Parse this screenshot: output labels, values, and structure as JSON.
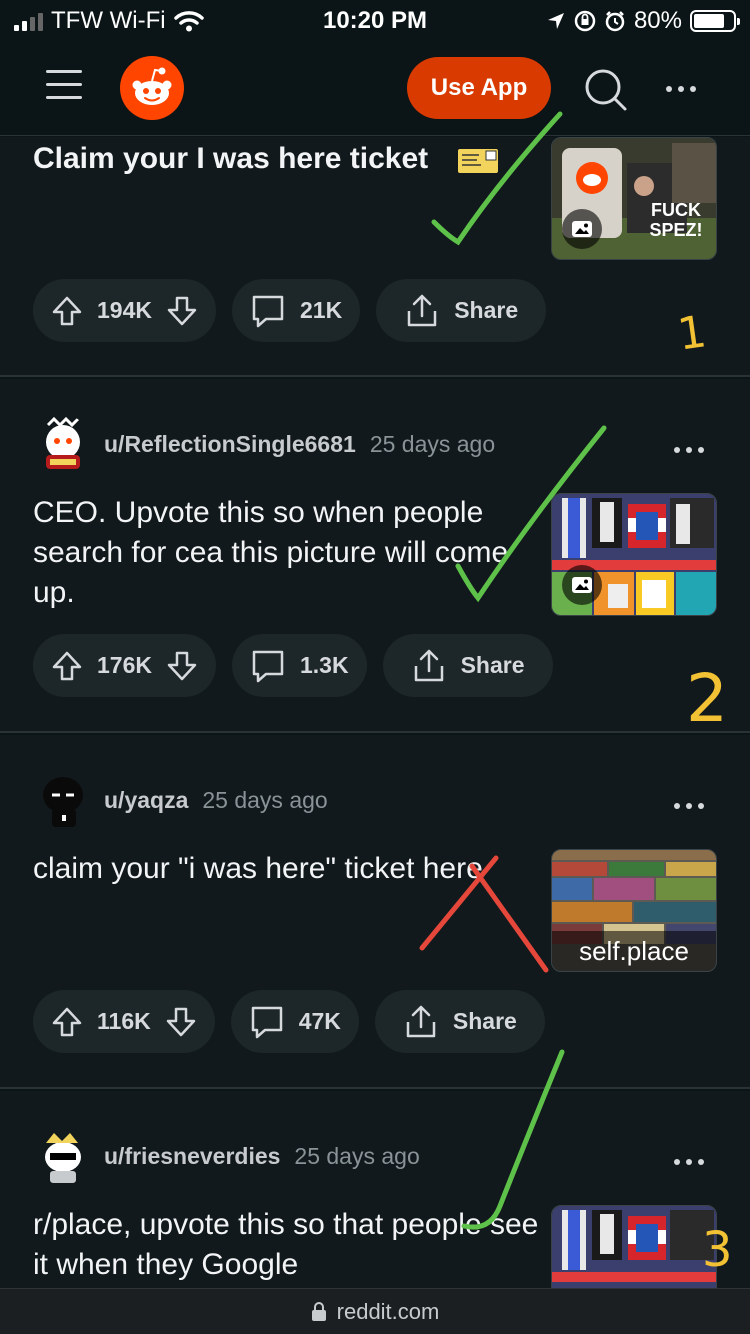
{
  "status_bar": {
    "carrier": "TFW Wi-Fi",
    "time": "10:20 PM",
    "battery": "80%",
    "battery_level": 0.8
  },
  "header": {
    "use_app_label": "Use App"
  },
  "posts": [
    {
      "title": "Claim your I was here ticket",
      "upvotes": "194K",
      "comments": "21K",
      "share_label": "Share",
      "thumb_text": "FUCK SPEZ!"
    },
    {
      "author": "u/ReflectionSingle6681",
      "age": "25 days ago",
      "title": "CEO. Upvote this so when people search for cea this picture will come up.",
      "upvotes": "176K",
      "comments": "1.3K",
      "share_label": "Share"
    },
    {
      "author": "u/yaqza",
      "age": "25 days ago",
      "title": "claim your \"i was here\" ticket here",
      "upvotes": "116K",
      "comments": "47K",
      "share_label": "Share",
      "thumb_caption": "self.place"
    },
    {
      "author": "u/friesneverdies",
      "age": "25 days ago",
      "title": "r/place, upvote this so that people see it when they Google"
    }
  ],
  "annotations": {
    "mark_1": "1",
    "mark_2": "2",
    "mark_3": "3"
  },
  "url_bar": {
    "domain": "reddit.com"
  },
  "colors": {
    "background": "#0b1416",
    "brand": "#ff4500",
    "use_app": "#d93a00",
    "check_green": "#5ec24a",
    "cross_red": "#e5473a",
    "number_yellow": "#f3c234"
  }
}
